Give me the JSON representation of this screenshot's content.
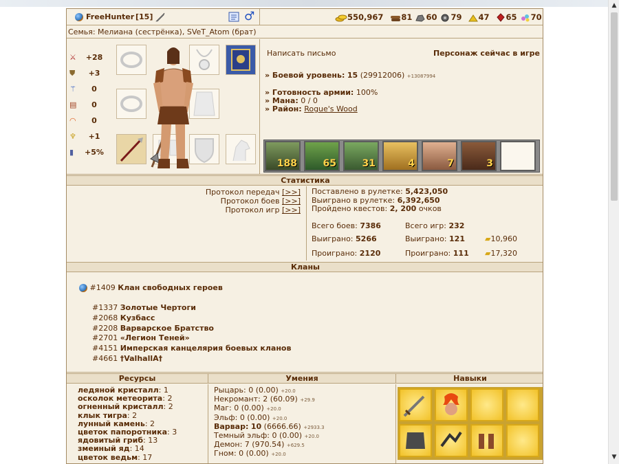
{
  "header": {
    "nickname": "FreeHunter",
    "level": "[15]",
    "resources": [
      {
        "name": "gold-icon",
        "value": "550,967",
        "color": "#e0b020"
      },
      {
        "name": "wood-icon",
        "value": "81",
        "color": "#8b5a2b"
      },
      {
        "name": "ore-icon",
        "value": "60",
        "color": "#707070"
      },
      {
        "name": "mercury-icon",
        "value": "79",
        "color": "#606060"
      },
      {
        "name": "sulfur-icon",
        "value": "47",
        "color": "#e8c020"
      },
      {
        "name": "crystal-icon",
        "value": "65",
        "color": "#c02020"
      },
      {
        "name": "gems-icon",
        "value": "70",
        "color": "#d080d0"
      }
    ]
  },
  "family": "Семья: Мелиана (сестрёнка), SVeT_Atom (брат)",
  "attributes": [
    {
      "icon": "swords-icon",
      "value": "+28"
    },
    {
      "icon": "shield-icon",
      "value": "+3"
    },
    {
      "icon": "wand-icon",
      "value": "0"
    },
    {
      "icon": "book-icon",
      "value": "0"
    },
    {
      "icon": "rainbow-icon",
      "value": "0"
    },
    {
      "icon": "wings-icon",
      "value": "+1"
    },
    {
      "icon": "potion-icon",
      "value": "+5%"
    }
  ],
  "info": {
    "write_letter": "Написать письмо",
    "online_status": "Персонаж сейчас в игре",
    "combat_level_label": "» Боевой уровень:",
    "combat_level_value": "15",
    "combat_level_exp": "(29912006)",
    "combat_level_next": "+13087994",
    "army_label": "» Готовность армии:",
    "army_value": "100%",
    "mana_label": "» Мана:",
    "mana_value": "0 / 0",
    "district_label": "» Район:",
    "district_value": "Rogue's Wood"
  },
  "army": [
    "188",
    "65",
    "31",
    "4",
    "7",
    "3"
  ],
  "stats": {
    "title": "Статистика",
    "protocols": [
      "Протокол передач",
      "Протокол боев",
      "Протокол игр"
    ],
    "link_text": "[>>]",
    "roulette_bet_label": "Поставлено в рулетке:",
    "roulette_bet_value": "5,423,050",
    "roulette_won_label": "Выиграно в рулетке:",
    "roulette_won_value": "6,392,650",
    "quests_label": "Пройдено квестов:",
    "quests_value": "2, 200",
    "quests_unit": "очков",
    "total_battles_label": "Всего боев:",
    "total_battles_value": "7386",
    "total_games_label": "Всего игр:",
    "total_games_value": "232",
    "won_battles_label": "Выиграно:",
    "won_battles_value": "5266",
    "won_games_label": "Выиграно:",
    "won_games_value": "121",
    "won_gold": "10,960",
    "lost_battles_label": "Проиграно:",
    "lost_battles_value": "2120",
    "lost_games_label": "Проиграно:",
    "lost_games_value": "111",
    "lost_gold": "17,320"
  },
  "clans": {
    "title": "Кланы",
    "main": {
      "id": "#1409",
      "name": "Клан свободных героев"
    },
    "list": [
      {
        "id": "#1337",
        "name": "Золотые Чертоги"
      },
      {
        "id": "#2068",
        "name": "Кузбасс"
      },
      {
        "id": "#2208",
        "name": "Варварское Братство"
      },
      {
        "id": "#2701",
        "name": "«Легион Теней»"
      },
      {
        "id": "#4151",
        "name": "Имперская канцелярия боевых кланов"
      },
      {
        "id": "#4661",
        "name": "†ValhallA†"
      }
    ]
  },
  "resources_section": {
    "title": "Ресурсы",
    "items": [
      {
        "name": "ледяной кристалл",
        "value": "1"
      },
      {
        "name": "осколок метеорита",
        "value": "2"
      },
      {
        "name": "огненный кристалл",
        "value": "2"
      },
      {
        "name": "клык тигра",
        "value": "2"
      },
      {
        "name": "лунный камень",
        "value": "2"
      },
      {
        "name": "цветок папоротника",
        "value": "3"
      },
      {
        "name": "ядовитый гриб",
        "value": "13"
      },
      {
        "name": "змеиный яд",
        "value": "14"
      },
      {
        "name": "цветок ведьм",
        "value": "17"
      }
    ]
  },
  "skills_section": {
    "title": "Умения",
    "items": [
      {
        "name": "Рыцарь",
        "value": "0 (0.00)",
        "plus": "+20.0",
        "bold": false
      },
      {
        "name": "Некромант",
        "value": "2 (60.09)",
        "plus": "+29.9",
        "bold": false
      },
      {
        "name": "Маг",
        "value": "0 (0.00)",
        "plus": "+20.0",
        "bold": false
      },
      {
        "name": "Эльф",
        "value": "0 (0.00)",
        "plus": "+20.0",
        "bold": false
      },
      {
        "name": "Варвар",
        "value": "10",
        "extra": "(6666.66)",
        "plus": "+2933.3",
        "bold": true
      },
      {
        "name": "Темный эльф",
        "value": "0 (0.00)",
        "plus": "+20.0",
        "bold": false
      },
      {
        "name": "Демон",
        "value": "7 (970.54)",
        "plus": "+629.5",
        "bold": false
      },
      {
        "name": "Гном",
        "value": "0 (0.00)",
        "plus": "+20.0",
        "bold": false
      }
    ]
  },
  "talents_section": {
    "title": "Навыки",
    "slots": [
      "sword-skill-icon",
      "fire-head-skill-icon",
      "",
      "",
      "armor-skill-icon",
      "ninja-skill-icon",
      "warriors-skill-icon",
      ""
    ]
  }
}
